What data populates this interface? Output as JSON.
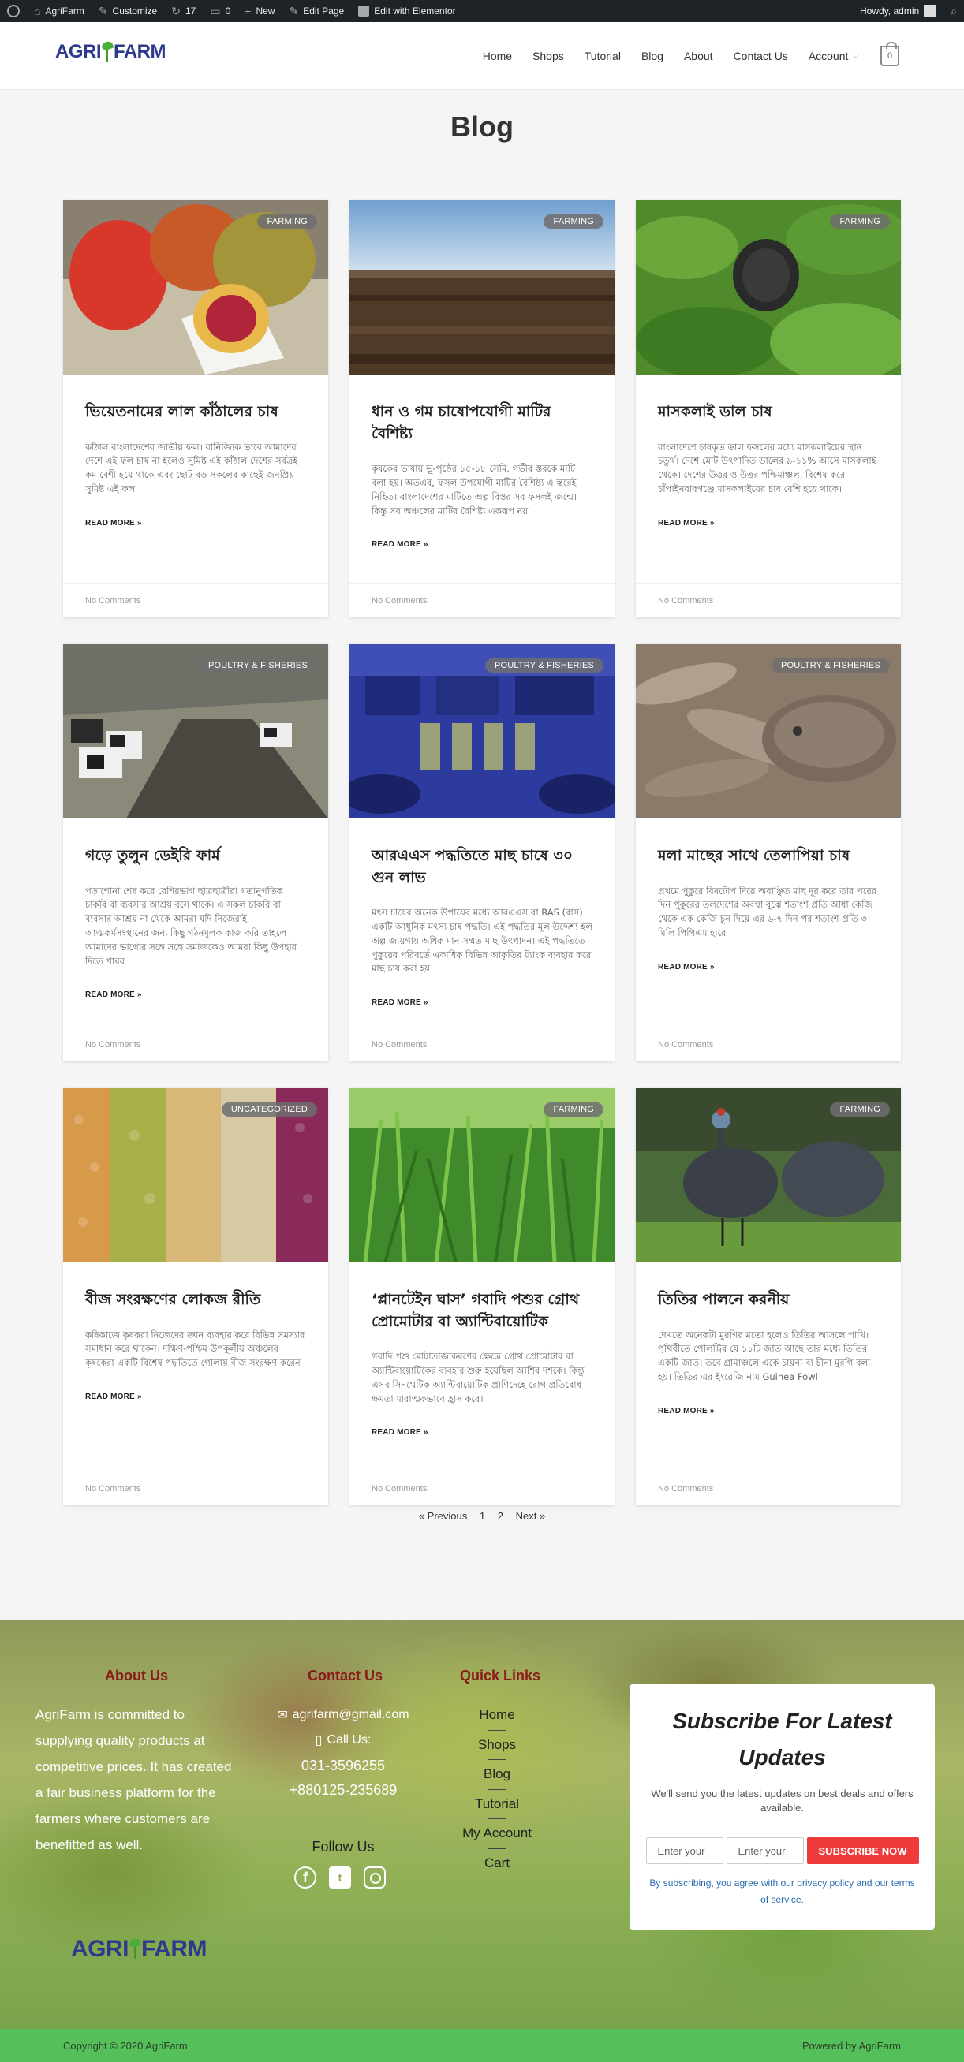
{
  "admin_bar": {
    "site": "AgriFarm",
    "customize": "Customize",
    "updates": "17",
    "comments": "0",
    "new": "New",
    "edit_page": "Edit Page",
    "elementor": "Edit with Elementor",
    "howdy": "Howdy, admin"
  },
  "header": {
    "logo_pre": "AGRI",
    "logo_post": "FARM",
    "nav": [
      "Home",
      "Shops",
      "Tutorial",
      "Blog",
      "About",
      "Contact Us",
      "Account"
    ],
    "cart_count": "0"
  },
  "page_title": "Blog",
  "posts": [
    {
      "category": "FARMING",
      "title": "ভিয়েতনামের লাল কাঁঠালের চাষ",
      "excerpt": "কাঁঠাল বাংলাদেশের জাতীয় ফল। বানিজ্যিক ভাবে আমাদের দেশে এই ফল চাষ না হলেও সুমিষ্ট এই কাঁঠাল দেশের সর্বত্রই কম বেশী হয়ে থাকে এবং ছোট বড় সকলের কাছেই জনপ্রিয় সুমিষ্ট এই ফল",
      "read_more": "READ MORE »",
      "comments": "No Comments"
    },
    {
      "category": "FARMING",
      "title": "ধান ও গম চাষোপযোগী মাটির বৈশিষ্ট্য",
      "excerpt": "কৃষকের ভাষায় ভূ-পৃষ্ঠের ১৫-১৮ সেমি. গভীর স্তরকে মাটি বলা হয়। অতএব, ফসল উপযোগী মাটির বৈশিষ্ট্য এ স্তরেই নিহিত। বাংলাদেশের মাটিতে অল্প বিস্তর সব ফসলই জন্মে। কিন্তু সব অঞ্চলের মাটির বৈশিষ্ট্য একরূপ নয়",
      "read_more": "READ MORE »",
      "comments": "No Comments"
    },
    {
      "category": "FARMING",
      "title": "মাসকলাই ডাল চাষ",
      "excerpt": "বাংলাদেশে চাষকৃত ডাল ফসলের মধ্যে মাসকলাইয়ের স্থান চতুর্থ। দেশে মোট উৎপাদিত ডালের ৯-১১% আসে মাসকলাই থেকে। দেশের উত্তর ও উত্তর পশ্চিমাঞ্চল, বিশেষ করে চাঁপাইনবাবগঞ্জে মাসকলাইয়ের চাষ বেশি হয়ে থাকে।",
      "read_more": "READ MORE »",
      "comments": "No Comments"
    },
    {
      "category": "POULTRY & FISHERIES",
      "title": "গড়ে তুলুন ডেইরি ফার্ম",
      "excerpt": "পড়াশোনা শেষ করে বেশিরভাগ ছাত্রছাত্রীরা গতানুগতিক চাকরি বা ব্যবসার আশ্রয় বসে থাকে। এ সকল চাকরি বা ব্যবসার আশ্রয় না থেকে আমরা যদি নিজেরাই আত্মকর্মসংস্থানের জন্য কিছু গঠনমূলক কাজ করি তাহলে আমাদের ভাগ্যের সঙ্গে সঙ্গে সমাজকেও আমরা কিছু উপহার দিতে পারব",
      "read_more": "READ MORE »",
      "comments": "No Comments"
    },
    {
      "category": "POULTRY & FISHERIES",
      "title": "আরএএস পদ্ধতিতে মাছ চাষে ৩০ গুন লাভ",
      "excerpt": "মৎস চাষের অনেক উপায়ের মধ্যে আরএএস বা RAS (রাস) একটি আধুনিক মৎস্য চাষ পদ্ধতি। এই পদ্ধতির মূল উদ্দেশ্য হল অল্প জায়গায় অধিক মান সম্মত মাছ উৎপাদন। এই পদ্ধতিতে পুকুরের পরিবর্তে একাধিক বিভিন্ন আকৃতির ট্যাংক ব্যবহার করে মাছ চাষ করা হয়",
      "read_more": "READ MORE »",
      "comments": "No Comments"
    },
    {
      "category": "POULTRY & FISHERIES",
      "title": "মলা মাছের সাথে তেলাপিয়া চাষ",
      "excerpt": "প্রথমে পুকুরে বিষটোপ দিয়ে অবাঞ্ছিত মাছ দূর করে তার পরের দিন পুকুরের তলদেশের অবস্থা বুঝে শতাংশ প্রতি আধা কেজি থেকে এক কেজি চুন দিয়ে এর ৬-৭ দিন পর শতাংশ প্রতি ৩ মিলি পিপিএম হারে",
      "read_more": "READ MORE »",
      "comments": "No Comments"
    },
    {
      "category": "UNCATEGORIZED",
      "title": "বীজ সংরক্ষণের লোকজ রীতি",
      "excerpt": "কৃষিকাজে কৃষকরা নিজেদের জ্ঞান ব্যবহার করে বিভিন্ন সমস্যার সমাধান করে থাকেন। দক্ষিণ-পশ্চিম উপকূলীয় অঞ্চলের কৃষকেরা একটি বিশেষ পদ্ধতিতে গোলায় বীজ সংরক্ষণ করেন",
      "read_more": "READ MORE »",
      "comments": "No Comments"
    },
    {
      "category": "FARMING",
      "title": "‘প্লানটেইন ঘাস’ গবাদি পশুর গ্রোথ প্রোমোটার বা অ্যান্টিবায়োটিক",
      "excerpt": "গবাদি পশু মোটাতাজাকরণের ক্ষেত্রে গ্রোথ প্রোমোটার বা অ্যান্টিবায়োটিকের ব্যবহার শুরু হয়েছিল আশির দশকে। কিন্তু এসব সিনথেটিক অ্যান্টিবায়োটিক প্রাণিদেহে রোগ প্রতিরোধ ক্ষমতা মারাত্মকভাবে হ্রাস করে।",
      "read_more": "READ MORE »",
      "comments": "No Comments"
    },
    {
      "category": "FARMING",
      "title": "তিতির পালনে করনীয়",
      "excerpt": "দেখতে অনেকটা মুরগির মতো হলেও তিতির আসলে পাখি। পৃথিবীতে পোলট্রির যে ১১টি জাত আছে তার মধ্যে তিতির একটি জাত। তবে গ্রামাঞ্চলে একে চায়না বা চীনা মুরগি বলা হয়। তিতির এর ইংরেজি নাম Guinea Fowl",
      "read_more": "READ MORE »",
      "comments": "No Comments"
    }
  ],
  "pagination": {
    "prev": "« Previous",
    "page1": "1",
    "page2": "2",
    "next": "Next »"
  },
  "footer": {
    "about_title": "About Us",
    "about_text": "AgriFarm is committed to supplying quality products at competitive prices. It has created a fair business platform for the farmers where customers are benefitted as well.",
    "contact_title": "Contact Us",
    "email": "agrifarm@gmail.com",
    "call_label": "Call Us:",
    "phone1": "031-3596255",
    "phone2": "+880125-235689",
    "follow_title": "Follow Us",
    "quick_title": "Quick Links",
    "quick_links": [
      "Home",
      "Shops",
      "Blog",
      "Tutorial",
      "My Account",
      "Cart"
    ],
    "subscribe_title": "Subscribe For Latest Updates",
    "subscribe_text": "We'll send you the latest updates on best deals and offers available.",
    "input1_placeholder": "Enter your",
    "input2_placeholder": "Enter your",
    "subscribe_button": "SUBSCRIBE NOW",
    "subscribe_note": "By subscribing, you agree with our privacy policy and our terms of service.",
    "copyright": "Copyright © 2020 AgriFarm",
    "powered": "Powered by AgriFarm"
  },
  "colors": {
    "accent_green": "#55c05a",
    "subscribe_red": "#ef3b3b",
    "footer_heading": "#8b1a1a",
    "logo_blue": "#2e3a8c"
  }
}
